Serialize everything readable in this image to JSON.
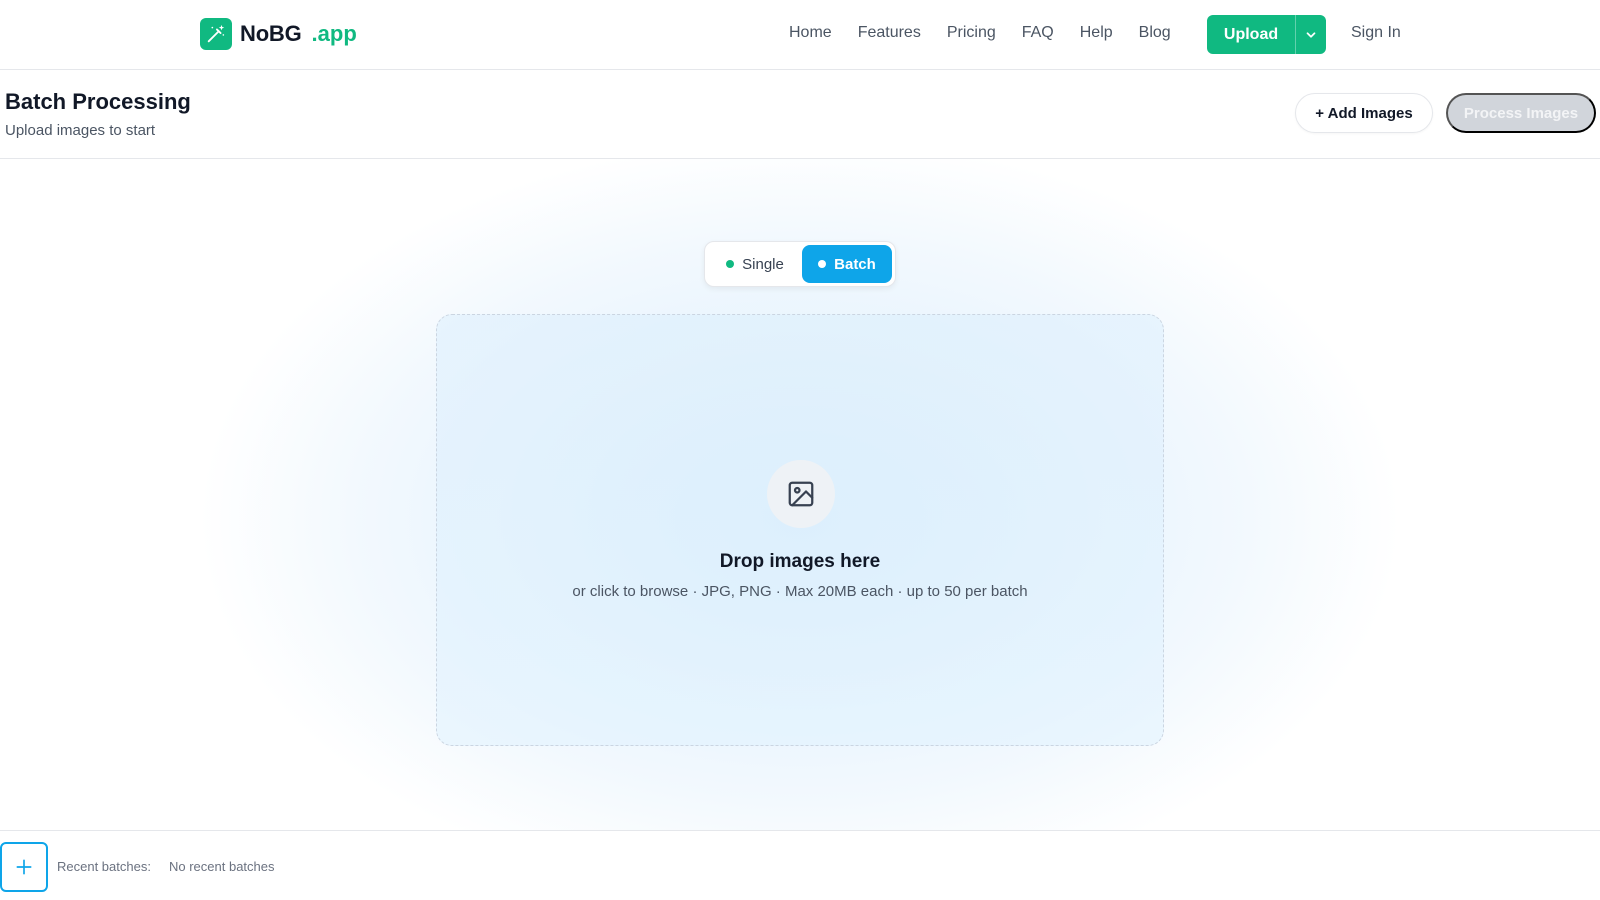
{
  "brand": {
    "name": "NoBG",
    "suffix": ".app"
  },
  "nav": {
    "links": [
      "Home",
      "Features",
      "Pricing",
      "FAQ",
      "Help",
      "Blog"
    ],
    "upload_label": "Upload",
    "sign_in_label": "Sign In"
  },
  "header": {
    "title": "Batch Processing",
    "subtitle": "Upload images to start",
    "add_images_label": "+ Add Images",
    "process_images_label": "Process Images"
  },
  "mode_toggle": {
    "single_label": "Single",
    "batch_label": "Batch",
    "selected": "Batch"
  },
  "dropzone": {
    "title": "Drop images here",
    "subtitle": "or click to browse · JPG, PNG · Max 20MB each · up to 50 per batch"
  },
  "footer": {
    "recent_label": "Recent batches:",
    "empty_text": "No recent batches"
  },
  "colors": {
    "brand_green": "#10b981",
    "accent_blue": "#0ea5e9",
    "disabled_gray": "#d1d5db"
  }
}
